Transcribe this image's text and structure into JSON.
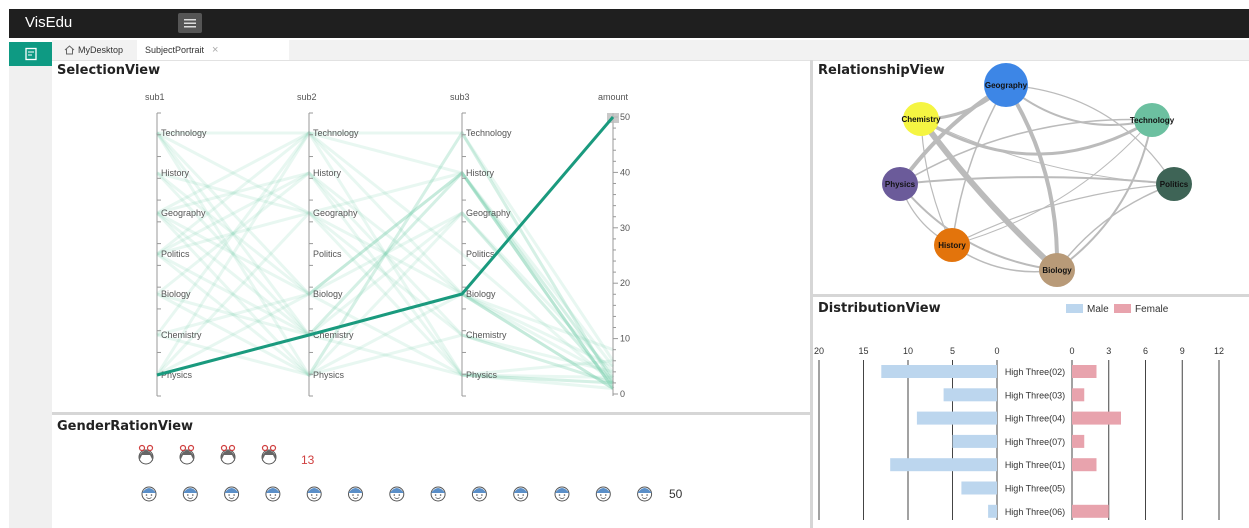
{
  "app": {
    "title": "VisEdu"
  },
  "tabs": [
    {
      "label": "MyDesktop"
    },
    {
      "label": "SubjectPortrait"
    }
  ],
  "selection_view": {
    "title": "SelectionView",
    "axes": [
      "sub1",
      "sub2",
      "sub3",
      "amount"
    ],
    "subjects": [
      "Technology",
      "History",
      "Geography",
      "Politics",
      "Biology",
      "Chemistry",
      "Physics"
    ],
    "amount_ticks": [
      "50",
      "40",
      "30",
      "20",
      "10",
      "0"
    ],
    "highlight": {
      "sub1": "Physics",
      "sub2": "Chemistry",
      "sub3": "Biology",
      "amount": 50
    },
    "highlight_color": "#1a9a7e"
  },
  "gender_view": {
    "title": "GenderRationView",
    "female_count": "13",
    "male_count": "50",
    "female_icons": 4,
    "male_icons": 13,
    "female_color": "#d04040",
    "male_color": "#5b8fc8"
  },
  "relationship_view": {
    "title": "RelationshipView",
    "nodes": [
      {
        "name": "Geography",
        "color": "#3d86e6"
      },
      {
        "name": "Chemistry",
        "color": "#f5f542"
      },
      {
        "name": "Technology",
        "color": "#6cc0a0"
      },
      {
        "name": "Physics",
        "color": "#6b5b9a"
      },
      {
        "name": "Politics",
        "color": "#3e6456"
      },
      {
        "name": "History",
        "color": "#e3740c"
      },
      {
        "name": "Biology",
        "color": "#b89a78"
      }
    ]
  },
  "distribution_view": {
    "title": "DistributionView",
    "legend": [
      {
        "label": "Male",
        "color": "#bcd6ee"
      },
      {
        "label": "Female",
        "color": "#e8a3ad"
      }
    ],
    "male_ticks": [
      "20",
      "15",
      "10",
      "5",
      "0"
    ],
    "female_ticks": [
      "0",
      "3",
      "6",
      "9",
      "12"
    ],
    "chart_data": {
      "type": "bar",
      "categories": [
        "High Three(02)",
        "High Three(03)",
        "High Three(04)",
        "High Three(07)",
        "High Three(01)",
        "High Three(05)",
        "High Three(06)"
      ],
      "series": [
        {
          "name": "Male",
          "values": [
            13,
            6,
            9,
            5,
            12,
            4,
            1
          ]
        },
        {
          "name": "Female",
          "values": [
            2,
            1,
            4,
            1,
            2,
            0,
            3
          ]
        }
      ]
    }
  }
}
